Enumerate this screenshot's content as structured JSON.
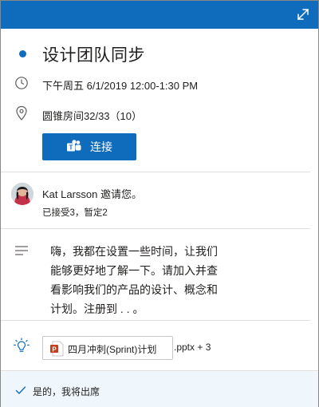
{
  "header": {
    "accent": "#0f6cbd",
    "expand_icon": "expand-diagonal-icon"
  },
  "event": {
    "title": "设计团队同步",
    "time": "下午周五 6/1/2019 12:00-1:30 PM",
    "location": "圆锥房间32/33（10）",
    "join_label": "连接"
  },
  "organizer": {
    "name": "Kat Larsson",
    "invite_suffix": " 邀请您。",
    "responses": "已接受3，暂定2"
  },
  "description": "嗨，我都在设置一些时间，让我们能够更好地了解一下。请加入并查看影响我们的产品的设计、概念和计划。注册到 . . 。",
  "attachment": {
    "name": "四月冲刺(Sprint)计划",
    "extra": ".pptx + 3",
    "icon": "powerpoint-file-icon"
  },
  "rsvp": {
    "status": "是的，我将出席",
    "icon": "checkmark-icon"
  }
}
